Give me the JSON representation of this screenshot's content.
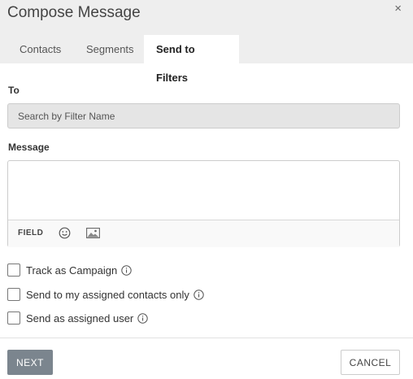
{
  "dialog": {
    "title": "Compose Message",
    "close_glyph": "×"
  },
  "tabs": [
    {
      "label": "Contacts",
      "active": false
    },
    {
      "label": "Segments",
      "active": false
    },
    {
      "label": "Send to Filters",
      "active": true
    }
  ],
  "to": {
    "label": "To",
    "search_placeholder": "Search by Filter Name",
    "search_value": ""
  },
  "message": {
    "label": "Message",
    "value": "",
    "toolbar": {
      "field_label": "FIELD",
      "icons": [
        "emoji-icon",
        "image-icon"
      ]
    }
  },
  "options": [
    {
      "label": "Track as Campaign",
      "checked": false,
      "icon": "info-icon"
    },
    {
      "label": "Send to my assigned contacts only",
      "checked": false,
      "icon": "info-icon"
    },
    {
      "label": "Send as assigned user",
      "checked": false,
      "icon": "info-icon"
    }
  ],
  "footer": {
    "next_label": "NEXT",
    "cancel_label": "CANCEL"
  },
  "colors": {
    "header_bg": "#eeeeee",
    "primary_button": "#7b858e"
  }
}
